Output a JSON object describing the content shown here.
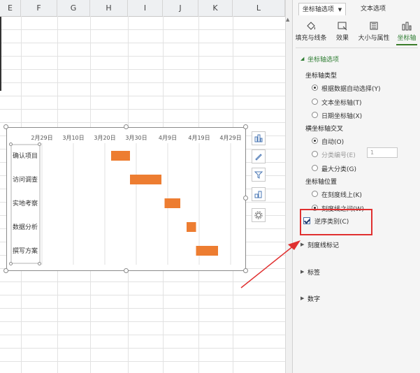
{
  "sheet": {
    "columns": [
      "E",
      "F",
      "G",
      "H",
      "I",
      "J",
      "K",
      "L"
    ]
  },
  "chart_data": {
    "type": "bar",
    "x_ticks": [
      "2月29日",
      "3月10日",
      "3月20日",
      "3月30日",
      "4月9日",
      "4月19日",
      "4月29日"
    ],
    "categories": [
      "确认项目",
      "访问调查",
      "实地考察",
      "数据分析",
      "撰写方案"
    ],
    "series": [
      {
        "start": [
          "2016-03-22",
          "2016-03-28",
          "2016-04-08",
          "2016-04-15",
          "2016-04-18"
        ],
        "duration_days": [
          6,
          10,
          5,
          3,
          7
        ]
      }
    ],
    "colors": {
      "bar": "#ed7d31"
    },
    "grid": true
  },
  "panel": {
    "tabs": [
      "坐标轴选项",
      "文本选项"
    ],
    "tools": [
      "填充与线条",
      "效果",
      "大小与属性",
      "坐标轴"
    ],
    "section_title": "坐标轴选项",
    "axis_type": {
      "title": "坐标轴类型",
      "options": [
        "根据数据自动选择(Y)",
        "文本坐标轴(T)",
        "日期坐标轴(X)"
      ]
    },
    "cross": {
      "title": "横坐标轴交叉",
      "options": [
        "自动(O)",
        "分类编号(E)",
        "最大分类(G)"
      ],
      "spin_value": "1"
    },
    "position": {
      "title": "坐标轴位置",
      "options": [
        "在刻度线上(K)",
        "刻度线之间(W)"
      ]
    },
    "reverse_label": "逆序类别(C)",
    "collapsed": [
      "刻度线标记",
      "标签",
      "数字"
    ]
  },
  "colors": {
    "accent_green": "#2e7d32",
    "highlight_red": "#e03030",
    "bar_orange": "#ed7d31"
  }
}
